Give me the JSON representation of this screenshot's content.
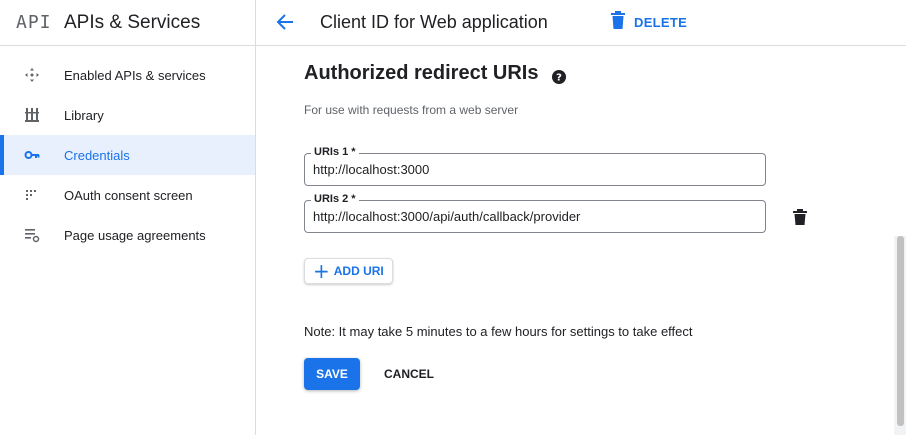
{
  "sidebar": {
    "logo_text": "API",
    "title": "APIs & Services",
    "items": [
      {
        "label": "Enabled APIs & services",
        "icon": "enabled-apis-icon"
      },
      {
        "label": "Library",
        "icon": "library-icon"
      },
      {
        "label": "Credentials",
        "icon": "key-icon",
        "active": true
      },
      {
        "label": "OAuth consent screen",
        "icon": "oauth-icon"
      },
      {
        "label": "Page usage agreements",
        "icon": "settings-list-icon"
      }
    ]
  },
  "topbar": {
    "title": "Client ID for Web application",
    "delete_label": "DELETE"
  },
  "section": {
    "title": "Authorized redirect URIs",
    "subtitle": "For use with requests from a web server"
  },
  "uris": [
    {
      "label": "URIs 1 *",
      "value": "http://localhost:3000"
    },
    {
      "label": "URIs 2 *",
      "value": "http://localhost:3000/api/auth/callback/provider"
    }
  ],
  "add_uri_label": "ADD URI",
  "note": "Note: It may take 5 minutes to a few hours for settings to take effect",
  "actions": {
    "save": "SAVE",
    "cancel": "CANCEL"
  },
  "colors": {
    "accent": "#1a73e8",
    "active_bg": "#e8f0fe"
  }
}
